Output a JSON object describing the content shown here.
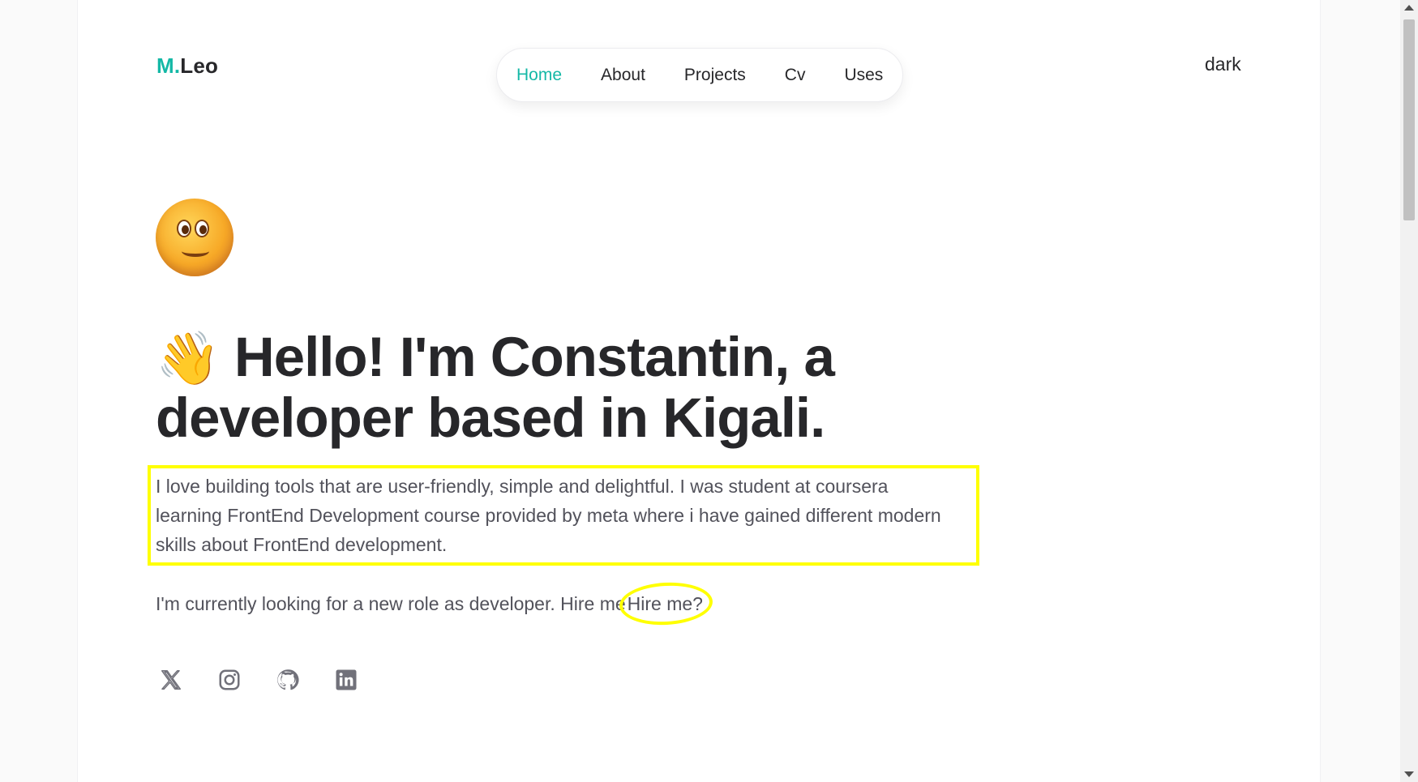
{
  "header": {
    "logo_prefix": "M.",
    "logo_name": "Leo",
    "nav": [
      {
        "label": "Home",
        "active": true
      },
      {
        "label": "About",
        "active": false
      },
      {
        "label": "Projects",
        "active": false
      },
      {
        "label": "Cv",
        "active": false
      },
      {
        "label": "Uses",
        "active": false
      }
    ],
    "theme_toggle_label": "dark"
  },
  "hero": {
    "avatar_icon": "smiling-face-icon",
    "wave_emoji": "👋",
    "headline": "Hello! I'm Constantin, a developer based in Kigali.",
    "bio": "I love building tools that are user-friendly, simple and delightful. I was student at coursera learning FrontEnd Development course provided by meta where i have gained different modern skills about FrontEnd development.",
    "cta_text": "I'm currently looking for a new role as developer. Hire me",
    "cta_link": "Hire me?"
  },
  "socials": [
    {
      "icon": "x-twitter-icon"
    },
    {
      "icon": "instagram-icon"
    },
    {
      "icon": "github-icon"
    },
    {
      "icon": "linkedin-icon"
    }
  ],
  "colors": {
    "accent": "#14b8a6",
    "text": "#27272a",
    "muted": "#52525b",
    "highlight": "#ffff00"
  }
}
